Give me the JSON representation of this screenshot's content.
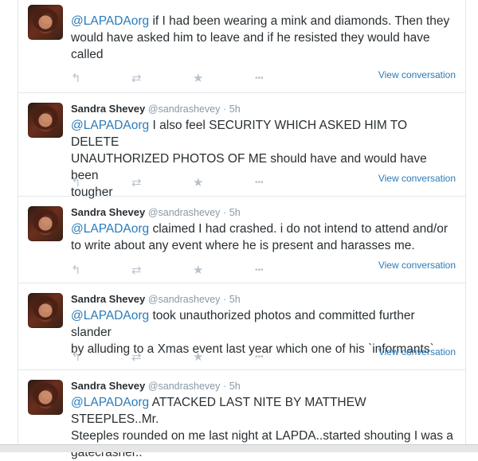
{
  "tweets": [
    {
      "name": "",
      "handle": "",
      "dot": "",
      "time": "",
      "mention": "@LAPADAorg",
      "lines": [
        " if I had been wearing a mink and diamonds.  Then they",
        "would have asked him to leave and if he resisted they would have",
        "called"
      ],
      "view": "View conversation"
    },
    {
      "name": "Sandra Shevey",
      "handle": "@sandrashevey",
      "dot": "·",
      "time": "5h",
      "mention": "@LAPADAorg",
      "lines": [
        " I also feel SECURITY WHICH ASKED HIM TO DELETE",
        "UNAUTHORIZED PHOTOS OF ME should have and would have been",
        "tougher"
      ],
      "view": "View conversation"
    },
    {
      "name": "Sandra Shevey",
      "handle": "@sandrashevey",
      "dot": "·",
      "time": "5h",
      "mention": "@LAPADAorg",
      "lines": [
        " claimed I had crashed.  i do not intend to attend and/or",
        "to write about any event where he is present and harasses me."
      ],
      "view": "View conversation"
    },
    {
      "name": "Sandra Shevey",
      "handle": "@sandrashevey",
      "dot": "·",
      "time": "5h",
      "mention": "@LAPADAorg",
      "lines": [
        " took unauthorized photos and committed further slander",
        "by alluding to a Xmas event last year which one of his `informants`"
      ],
      "view": "View conversation"
    },
    {
      "name": "Sandra Shevey",
      "handle": "@sandrashevey",
      "dot": "·",
      "time": "5h",
      "mention": "@LAPADAorg",
      "lines": [
        " ATTACKED LAST NITE BY MATTHEW STEEPLES..Mr.",
        "Steeples rounded on me last night at LAPDA..started shouting I was a",
        "gatecrasher.."
      ],
      "view": ""
    }
  ],
  "icons": {
    "reply": "↰",
    "retweet": "⇄",
    "favorite": "★",
    "more": "•••"
  },
  "colors": {
    "link": "#2b7bb9",
    "text": "#292f33",
    "muted": "#8899a6",
    "action": "#b7c2cb",
    "border": "#e1e8ed"
  }
}
